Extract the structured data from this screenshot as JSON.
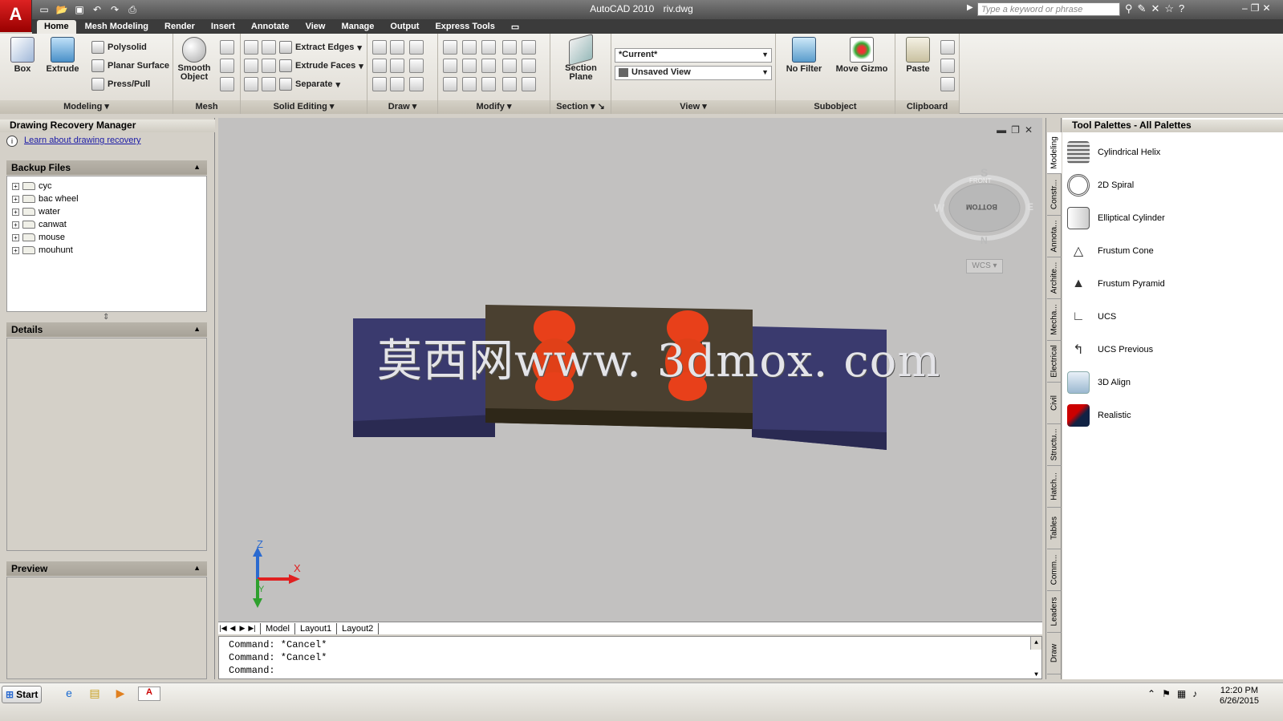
{
  "window": {
    "app_title": "AutoCAD 2010",
    "file_name": "riv.dwg",
    "logo_letter": "A",
    "search_placeholder": "Type a keyword or phrase"
  },
  "ribbon_tabs": [
    "Home",
    "Mesh Modeling",
    "Render",
    "Insert",
    "Annotate",
    "View",
    "Manage",
    "Output",
    "Express Tools"
  ],
  "ribbon": {
    "modeling": {
      "title": "Modeling",
      "box": "Box",
      "extrude": "Extrude",
      "polysolid": "Polysolid",
      "planar_surface": "Planar Surface",
      "press_pull": "Press/Pull"
    },
    "mesh": {
      "title": "Mesh",
      "smooth_object_1": "Smooth",
      "smooth_object_2": "Object"
    },
    "solid_editing": {
      "title": "Solid Editing",
      "extract_edges": "Extract Edges",
      "extrude_faces": "Extrude Faces",
      "separate": "Separate"
    },
    "draw": {
      "title": "Draw"
    },
    "modify": {
      "title": "Modify"
    },
    "section": {
      "title": "Section",
      "section_plane_1": "Section",
      "section_plane_2": "Plane"
    },
    "view": {
      "title": "View",
      "visual_style": "*Current*",
      "named_view": "Unsaved View"
    },
    "subobject": {
      "title": "Subobject",
      "no_filter": "No Filter",
      "move_gizmo": "Move Gizmo"
    },
    "clipboard": {
      "title": "Clipboard",
      "paste": "Paste"
    }
  },
  "recovery_manager": {
    "title": "Drawing Recovery Manager",
    "info_link": "Learn about drawing recovery",
    "backup_header": "Backup Files",
    "backup_files": [
      "cyc",
      "bac wheel",
      "water",
      "canwat",
      "mouse",
      "mouhunt"
    ],
    "details_header": "Details",
    "preview_header": "Preview"
  },
  "viewport": {
    "viewcube": {
      "top": "S",
      "bottom": "N",
      "left": "W",
      "right": "E",
      "face_top": "FRONT",
      "face": "BOTTOM"
    },
    "wcs_label": "WCS",
    "watermark": "莫西网www. 3dmox. com",
    "ucs_z": "Z",
    "ucs_x": "X",
    "ucs_y": "Y"
  },
  "layout_tabs": [
    "Model",
    "Layout1",
    "Layout2"
  ],
  "command_lines": [
    "Command: *Cancel*",
    "Command: *Cancel*",
    "Command:"
  ],
  "tool_palette": {
    "title": "Tool Palettes - All Palettes",
    "side_tabs": [
      "Modeling",
      "Constr...",
      "Annota...",
      "Archite...",
      "Mecha...",
      "Electrical",
      "Civil",
      "Structu...",
      "Hatch...",
      "Tables",
      "Comm...",
      "Leaders",
      "Draw"
    ],
    "tools": [
      "Cylindrical Helix",
      "2D Spiral",
      "Elliptical Cylinder",
      "Frustum Cone",
      "Frustum Pyramid",
      "UCS",
      "UCS Previous",
      "3D Align",
      "Realistic"
    ]
  },
  "taskbar": {
    "start": "Start",
    "time": "12:20 PM",
    "date": "6/26/2015"
  },
  "colors": {
    "model_body": "#3a3a6e",
    "model_block": "#4a4030",
    "rivet": "#e8401a",
    "viewport_bg": "#c2c1c0"
  }
}
